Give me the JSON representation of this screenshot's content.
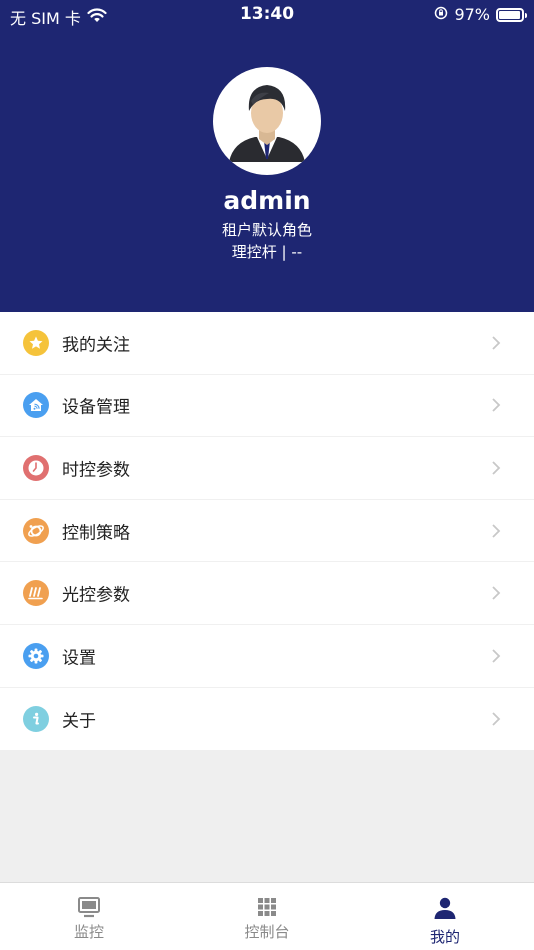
{
  "status_bar": {
    "carrier": "无 SIM 卡",
    "time": "13:40",
    "battery_percent": "97%",
    "battery_level": 0.97
  },
  "profile": {
    "username": "admin",
    "role": "租户默认角色",
    "org": "理控杆 | --"
  },
  "menu": {
    "items": [
      {
        "label": "我的关注",
        "icon": "star-icon",
        "color": "#f5c33b"
      },
      {
        "label": "设备管理",
        "icon": "home-wifi-icon",
        "color": "#4a9ff0"
      },
      {
        "label": "时控参数",
        "icon": "clock-icon",
        "color": "#e07070"
      },
      {
        "label": "控制策略",
        "icon": "strategy-icon",
        "color": "#f0a050"
      },
      {
        "label": "光控参数",
        "icon": "light-icon",
        "color": "#f0a050"
      },
      {
        "label": "设置",
        "icon": "gear-icon",
        "color": "#4a9ff0"
      },
      {
        "label": "关于",
        "icon": "info-icon",
        "color": "#7fcfe0"
      }
    ]
  },
  "tabbar": {
    "tabs": [
      {
        "label": "监控",
        "icon": "monitor-icon"
      },
      {
        "label": "控制台",
        "icon": "grid-icon"
      },
      {
        "label": "我的",
        "icon": "person-icon",
        "active": true
      }
    ]
  },
  "colors": {
    "header_bg": "#1e2672",
    "active_tab": "#1e2672"
  }
}
